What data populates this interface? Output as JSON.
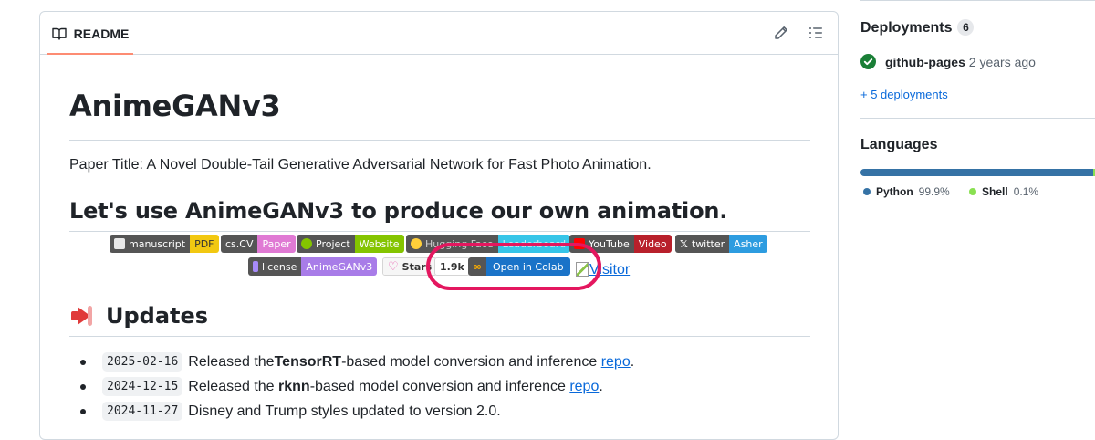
{
  "readme": {
    "tab_label": "README",
    "title": "AnimeGANv3",
    "paper_line": "Paper Title: A Novel Double-Tail Generative Adversarial Network for Fast Photo Animation.",
    "heading2": "Let's use AnimeGANv3 to produce our own animation.",
    "badges_row1": [
      {
        "left": "manuscript",
        "right": "PDF",
        "right_color": "#f2c811",
        "icon_color": "#e8e8e8"
      },
      {
        "left": "cs.CV",
        "right": "Paper",
        "right_color": "#e07ad4",
        "icon_color": ""
      },
      {
        "left": "Project",
        "right": "Website",
        "right_color": "#84c400",
        "icon_color": "#84c400"
      },
      {
        "left": "Hugging Face",
        "right": "Leaderboard",
        "right_color": "#36c5e8",
        "icon_color": "#ffcf3a"
      },
      {
        "left": "YouTube",
        "right": "Video",
        "right_color": "#b8202b",
        "icon_color": "#ff0000"
      },
      {
        "left": "twitter",
        "right": "Asher",
        "right_color": "#2d9ce0",
        "icon_color": "#ffffff"
      }
    ],
    "badges_row2": {
      "license_left": "license",
      "license_right": "AnimeGANv3",
      "stars_label": "Stars",
      "stars_count": "1.9k",
      "colab_label": "Open in Colab",
      "visitor_text": "Visitor"
    },
    "updates_heading": "Updates",
    "updates": [
      {
        "date": "2025-02-16",
        "pre": "Released the ",
        "bold": "TensorRT",
        "post": "-based model conversion and inference ",
        "link": "repo",
        "end": "."
      },
      {
        "date": "2024-12-15",
        "pre": "Released the ",
        "bold": "rknn",
        "post": "-based model conversion and inference ",
        "link": "repo",
        "end": "."
      },
      {
        "date": "2024-11-27",
        "pre": "Disney and Trump styles updated to version 2.0.",
        "bold": "",
        "post": "",
        "link": "",
        "end": ""
      }
    ]
  },
  "sidebar": {
    "deployments_title": "Deployments",
    "deployments_count": "6",
    "deployment_name": "github-pages",
    "deployment_time": "2 years ago",
    "more_deployments": "+ 5 deployments",
    "languages_title": "Languages",
    "languages": [
      {
        "name": "Python",
        "percent": "99.9%",
        "color": "#3572a5",
        "share": 99.9
      },
      {
        "name": "Shell",
        "percent": "0.1%",
        "color": "#89e051",
        "share": 0.1
      }
    ]
  },
  "colors": {
    "accent": "#0969da",
    "tab_underline": "#fd8c73",
    "highlight_ring": "#e4175f",
    "success": "#1a7f37"
  }
}
